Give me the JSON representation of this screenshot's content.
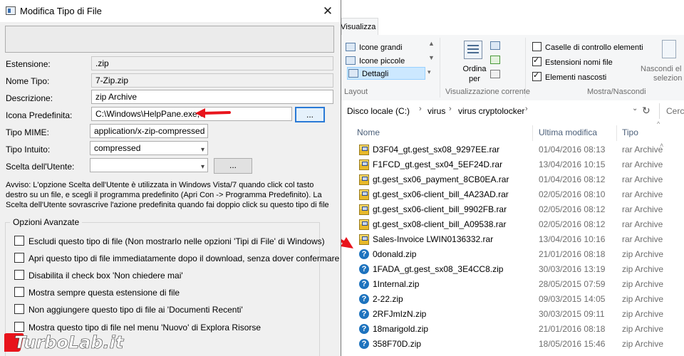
{
  "dialog": {
    "title": "Modifica Tipo di File",
    "fields": {
      "estensione": {
        "label": "Estensione:",
        "value": ".zip"
      },
      "nome_tipo": {
        "label": "Nome Tipo:",
        "value": "7-Zip.zip"
      },
      "descrizione": {
        "label": "Descrizione:",
        "value": "zip Archive"
      },
      "icona": {
        "label": "Icona Predefinita:",
        "value": "C:\\Windows\\HelpPane.exe,0",
        "button": "..."
      },
      "mime": {
        "label": "Tipo MIME:",
        "value": "application/x-zip-compressed"
      },
      "intuito": {
        "label": "Tipo Intuito:",
        "value": "compressed"
      },
      "scelta": {
        "label": "Scelta dell'Utente:",
        "value": "",
        "button": "..."
      }
    },
    "warning": "Avviso: L'opzione Scelta dell'Utente è utilizzata in Windows Vista/7 quando click col tasto destro su un file, e scegli il programma predefinito (Apri Con -> Programma Predefinito). La Scelta dell'Utente sovrascrive l'azione predefinita quando fai doppio click su questo tipo di file",
    "advanced": {
      "title": "Opzioni Avanzate",
      "options": [
        "Escludi questo tipo di file (Non mostrarlo nelle opzioni 'Tipi di File' di Windows)",
        "Apri questo tipo di file immediatamente dopo il download, senza dover confermare",
        "Disabilita il check box 'Non chiedere mai'",
        "Mostra sempre questa estensione di file",
        "Non aggiungere questo tipo di file ai 'Documenti Recenti'",
        "Mostra questo tipo di file nel menu 'Nuovo' di Explora Risorse"
      ]
    }
  },
  "watermark": "TurboLab.it",
  "explorer": {
    "ribbon": {
      "tab": "Visualizza",
      "layout": {
        "items": [
          "Icone grandi",
          "Icone piccole",
          "Dettagli"
        ],
        "label": "Layout"
      },
      "vista_corrente": {
        "ordina_label": "Ordina per",
        "label": "Visualizzazione corrente"
      },
      "mostra": {
        "items": [
          {
            "label": "Caselle di controllo elementi",
            "checked": false
          },
          {
            "label": "Estensioni nomi file",
            "checked": true
          },
          {
            "label": "Elementi nascosti",
            "checked": true
          }
        ],
        "label": "Mostra/Nascondi"
      },
      "nascondi_label_1": "Nascondi el",
      "nascondi_label_2": "selezion"
    },
    "address": {
      "crumbs": [
        "Disco locale (C:)",
        "virus",
        "virus cryptolocker"
      ],
      "search_placeholder": "Cerca"
    },
    "columns": {
      "name": "Nome",
      "date": "Ultima modifica",
      "type": "Tipo"
    },
    "files": [
      {
        "name": "D3F04_gt.gest_sx08_9297EE.rar",
        "date": "01/04/2016 08:13",
        "type": "rar Archive",
        "icon": "rar-icon"
      },
      {
        "name": "F1FCD_gt.gest_sx04_5EF24D.rar",
        "date": "13/04/2016 10:15",
        "type": "rar Archive",
        "icon": "rar-icon"
      },
      {
        "name": "gt.gest_sx06_payment_8CB0EA.rar",
        "date": "01/04/2016 08:12",
        "type": "rar Archive",
        "icon": "rar-icon"
      },
      {
        "name": "gt.gest_sx06-client_bill_4A23AD.rar",
        "date": "02/05/2016 08:10",
        "type": "rar Archive",
        "icon": "rar-icon"
      },
      {
        "name": "gt.gest_sx06-client_bill_9902FB.rar",
        "date": "02/05/2016 08:12",
        "type": "rar Archive",
        "icon": "rar-icon"
      },
      {
        "name": "gt.gest_sx08-client_bill_A09538.rar",
        "date": "02/05/2016 08:12",
        "type": "rar Archive",
        "icon": "rar-icon"
      },
      {
        "name": "Sales-Invoice  LWIN0136332.rar",
        "date": "13/04/2016 10:16",
        "type": "rar Archive",
        "icon": "rar-icon"
      },
      {
        "name": "0donald.zip",
        "date": "21/01/2016 08:18",
        "type": "zip Archive",
        "icon": "help-icon"
      },
      {
        "name": "1FADA_gt.gest_sx08_3E4CC8.zip",
        "date": "30/03/2016 13:19",
        "type": "zip Archive",
        "icon": "help-icon"
      },
      {
        "name": "1Internal.zip",
        "date": "28/05/2015 07:59",
        "type": "zip Archive",
        "icon": "help-icon"
      },
      {
        "name": "2-22.zip",
        "date": "09/03/2015 14:05",
        "type": "zip Archive",
        "icon": "help-icon"
      },
      {
        "name": "2RFJmIzN.zip",
        "date": "30/03/2015 09:11",
        "type": "zip Archive",
        "icon": "help-icon"
      },
      {
        "name": "18marigold.zip",
        "date": "21/01/2016 08:18",
        "type": "zip Archive",
        "icon": "help-icon"
      },
      {
        "name": "358F70D.zip",
        "date": "18/05/2016 15:46",
        "type": "zip Archive",
        "icon": "help-icon"
      }
    ],
    "colors": {
      "selection": "#cce8ff",
      "header_text": "#4c607a",
      "annotation_arrow": "#e8141c"
    }
  }
}
